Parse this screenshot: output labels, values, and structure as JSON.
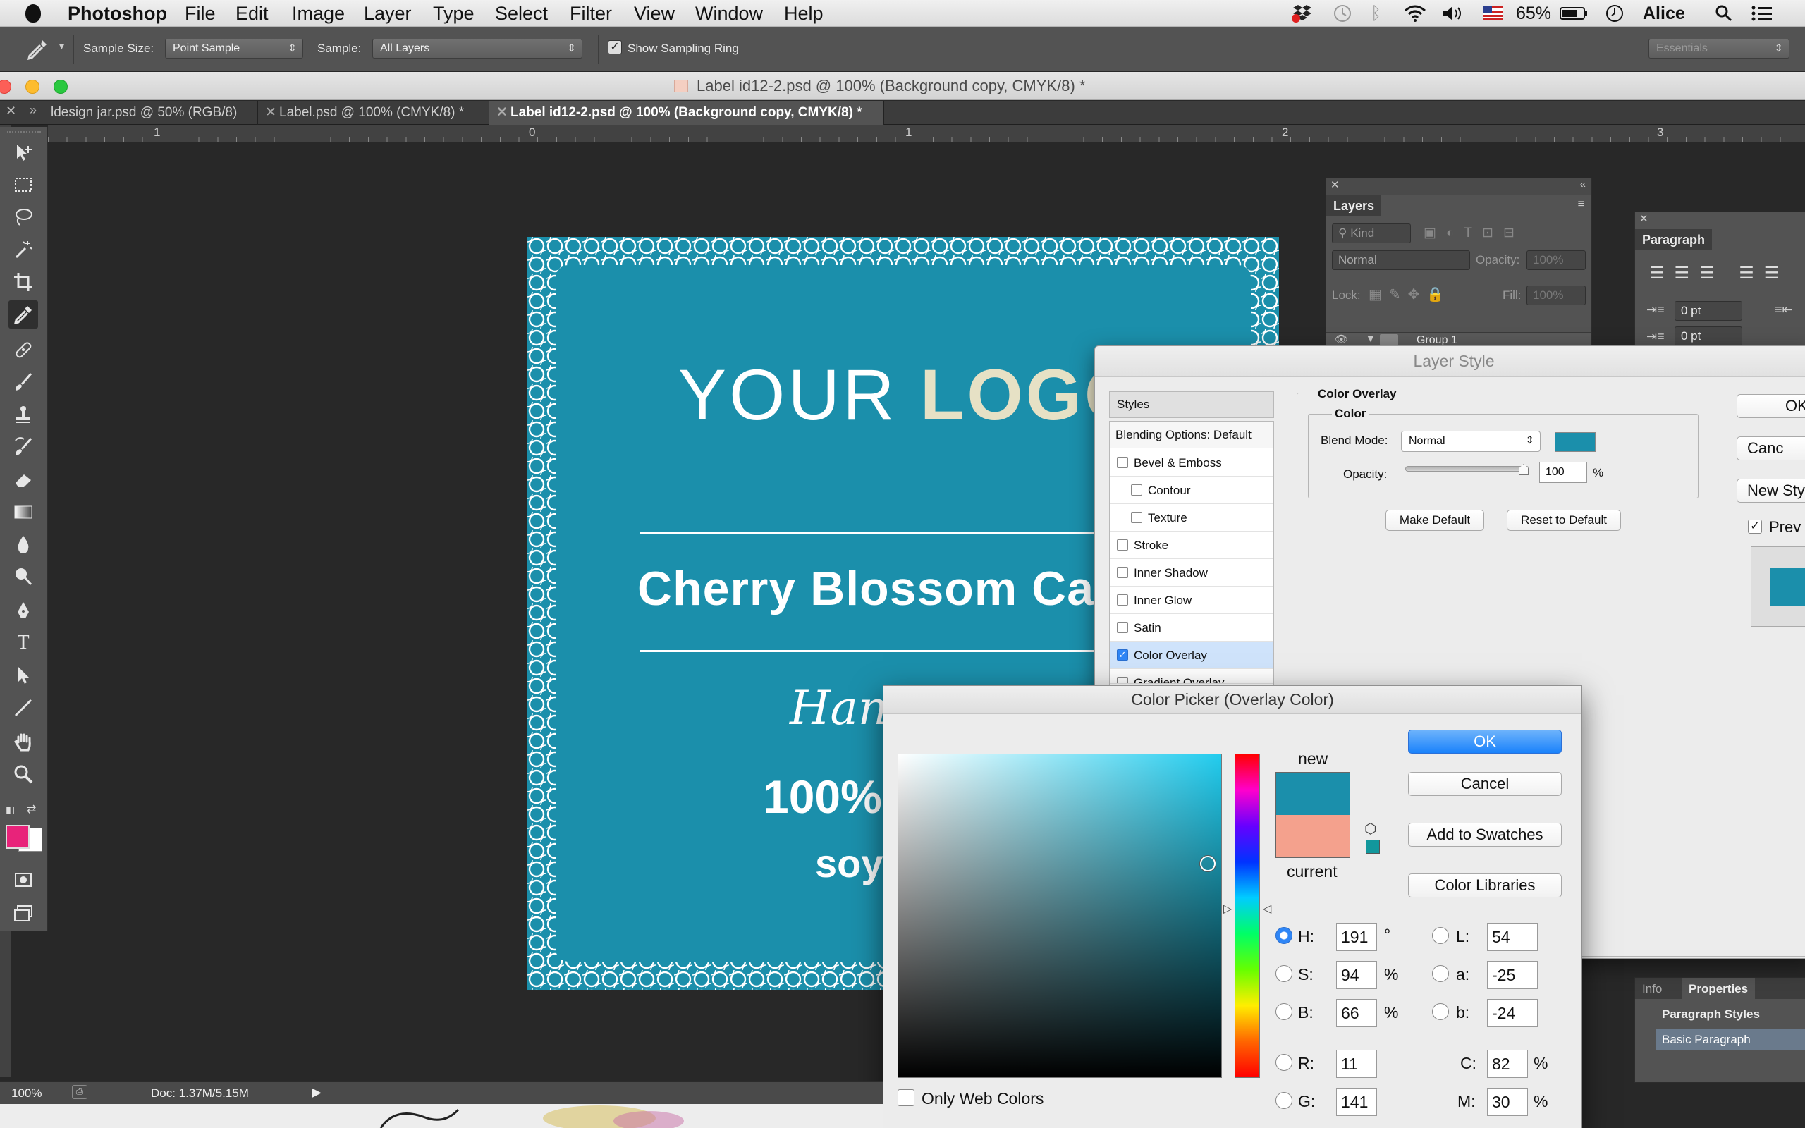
{
  "menubar": {
    "app": "Photoshop",
    "menus": [
      "File",
      "Edit",
      "Image",
      "Layer",
      "Type",
      "Select",
      "Filter",
      "View",
      "Window",
      "Help"
    ],
    "battery": "65%",
    "user": "Alice"
  },
  "options": {
    "sample_size_label": "Sample Size:",
    "sample_size_value": "Point Sample",
    "sample_label": "Sample:",
    "sample_value": "All Layers",
    "sampling_ring_label": "Show Sampling Ring",
    "workspace": "Essentials"
  },
  "window": {
    "title": "Label id12-2.psd @ 100% (Background copy, CMYK/8) *"
  },
  "tabs": [
    {
      "label": "ldesign jar.psd @ 50% (RGB/8)"
    },
    {
      "label": "Label.psd @ 100% (CMYK/8) *"
    },
    {
      "label": "Label id12-2.psd @ 100% (Background copy, CMYK/8) *"
    }
  ],
  "ruler": {
    "marks": [
      "1",
      "0",
      "1",
      "2",
      "3"
    ]
  },
  "colors": {
    "foreground": "#e8237a",
    "background": "#ffffff",
    "label_teal": "#1b8fab",
    "overlay_current": "#f4a18d"
  },
  "artwork": {
    "logo_part1": "YOUR ",
    "logo_part2": "LOGO",
    "product": "Cherry Blossom Can",
    "script_text": "Hand",
    "line1": "100%",
    "line2": "soy"
  },
  "layers_panel": {
    "title": "Layers",
    "filter": "Kind",
    "blend": "Normal",
    "opacity_label": "Opacity:",
    "opacity_value": "100%",
    "lock_label": "Lock:",
    "fill_label": "Fill:",
    "fill_value": "100%",
    "group": "Group 1"
  },
  "paragraph_panel": {
    "title": "Paragraph",
    "indent1": "0 pt",
    "indent2": "0 pt"
  },
  "info_panel": {
    "tabs": [
      "Info",
      "Properties"
    ],
    "styles_tab": "Paragraph Styles",
    "style": "Basic Paragraph"
  },
  "layer_style": {
    "title": "Layer Style",
    "list_header": "Styles",
    "items": [
      {
        "label": "Blending Options: Default",
        "checkbox": false,
        "sub": false,
        "checked": false
      },
      {
        "label": "Bevel & Emboss",
        "checkbox": true,
        "sub": false,
        "checked": false
      },
      {
        "label": "Contour",
        "checkbox": true,
        "sub": true,
        "checked": false
      },
      {
        "label": "Texture",
        "checkbox": true,
        "sub": true,
        "checked": false
      },
      {
        "label": "Stroke",
        "checkbox": true,
        "sub": false,
        "checked": false
      },
      {
        "label": "Inner Shadow",
        "checkbox": true,
        "sub": false,
        "checked": false
      },
      {
        "label": "Inner Glow",
        "checkbox": true,
        "sub": false,
        "checked": false
      },
      {
        "label": "Satin",
        "checkbox": true,
        "sub": false,
        "checked": false
      },
      {
        "label": "Color Overlay",
        "checkbox": true,
        "sub": false,
        "checked": true
      },
      {
        "label": "Gradient Overlay",
        "checkbox": true,
        "sub": false,
        "checked": false
      }
    ],
    "section_title": "Color Overlay",
    "group_title": "Color",
    "blend_mode_label": "Blend Mode:",
    "blend_mode_value": "Normal",
    "opacity_label": "Opacity:",
    "opacity_value": "100",
    "opacity_unit": "%",
    "opacity_fraction": 1.0,
    "make_default": "Make Default",
    "reset_default": "Reset to Default",
    "ok": "OK",
    "cancel": "Canc",
    "new_style": "New Sty",
    "preview": "Prev"
  },
  "color_picker": {
    "title": "Color Picker (Overlay Color)",
    "new_label": "new",
    "current_label": "current",
    "ok": "OK",
    "cancel": "Cancel",
    "add_swatches": "Add to Swatches",
    "libraries": "Color Libraries",
    "only_web": "Only Web Colors",
    "hsb": [
      {
        "key": "H:",
        "value": "191",
        "unit": "°",
        "selected": true
      },
      {
        "key": "S:",
        "value": "94",
        "unit": "%",
        "selected": false
      },
      {
        "key": "B:",
        "value": "66",
        "unit": "%",
        "selected": false
      }
    ],
    "rgb": [
      {
        "key": "R:",
        "value": "11"
      },
      {
        "key": "G:",
        "value": "141"
      }
    ],
    "lab": [
      {
        "key": "L:",
        "value": "54"
      },
      {
        "key": "a:",
        "value": "-25"
      },
      {
        "key": "b:",
        "value": "-24"
      }
    ],
    "cmyk": [
      {
        "key": "C:",
        "value": "82",
        "unit": "%"
      },
      {
        "key": "M:",
        "value": "30",
        "unit": "%"
      }
    ]
  },
  "status": {
    "zoom": "100%",
    "doc": "Doc: 1.37M/5.15M"
  }
}
